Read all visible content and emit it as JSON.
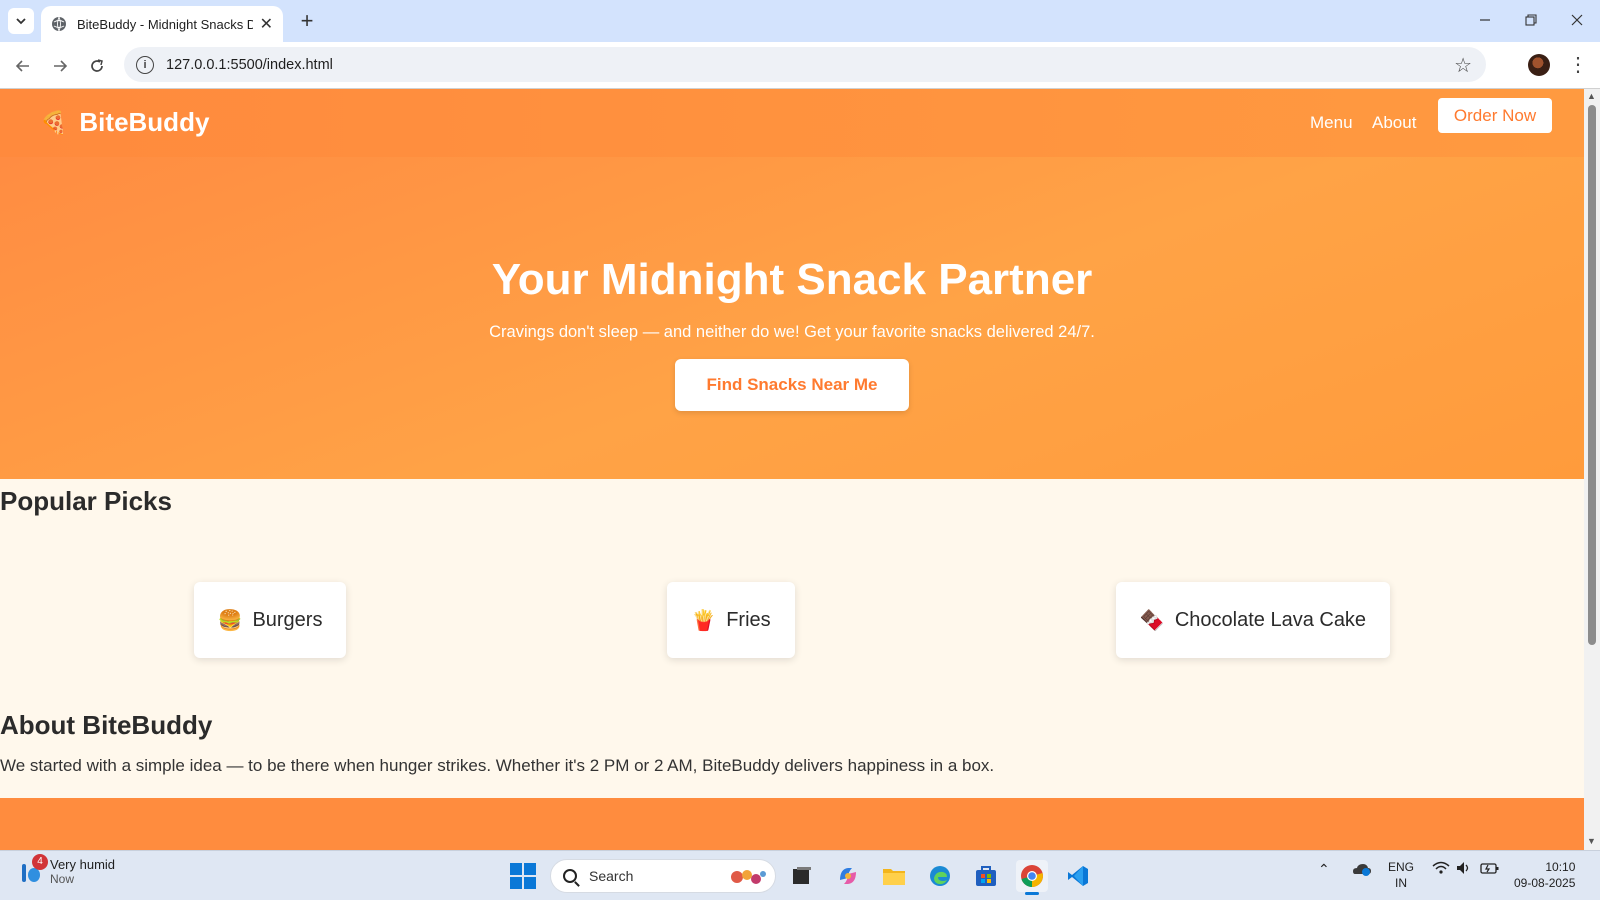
{
  "browser": {
    "tab_title": "BiteBuddy - Midnight Snacks D",
    "url": "127.0.0.1:5500/index.html"
  },
  "site": {
    "logo_icon": "🍕",
    "logo_text": "BiteBuddy",
    "nav": [
      "Menu",
      "About"
    ],
    "order_button": "Order Now",
    "hero_title": "Your Midnight Snack Partner",
    "hero_subtitle": "Cravings don't sleep — and neither do we! Get your favorite snacks delivered 24/7.",
    "hero_button": "Find Snacks Near Me",
    "popular_title": "Popular Picks",
    "picks": [
      {
        "emoji": "🍔",
        "label": "Burgers"
      },
      {
        "emoji": "🍟",
        "label": "Fries"
      },
      {
        "emoji": "🍫",
        "label": "Chocolate Lava Cake"
      }
    ],
    "about_title": "About BiteBuddy",
    "about_text": "We started with a simple idea — to be there when hunger strikes. Whether it's 2 PM or 2 AM, BiteBuddy delivers happiness in a box.",
    "colors": {
      "primary": "#ff8a3d",
      "accent": "#ff7a2f",
      "background": "#fff8ec"
    }
  },
  "taskbar": {
    "weather_badge": "4",
    "weather_text": "Very humid",
    "weather_time": "Now",
    "search_label": "Search",
    "lang_top": "ENG",
    "lang_bottom": "IN",
    "time": "10:10",
    "date": "09-08-2025"
  }
}
